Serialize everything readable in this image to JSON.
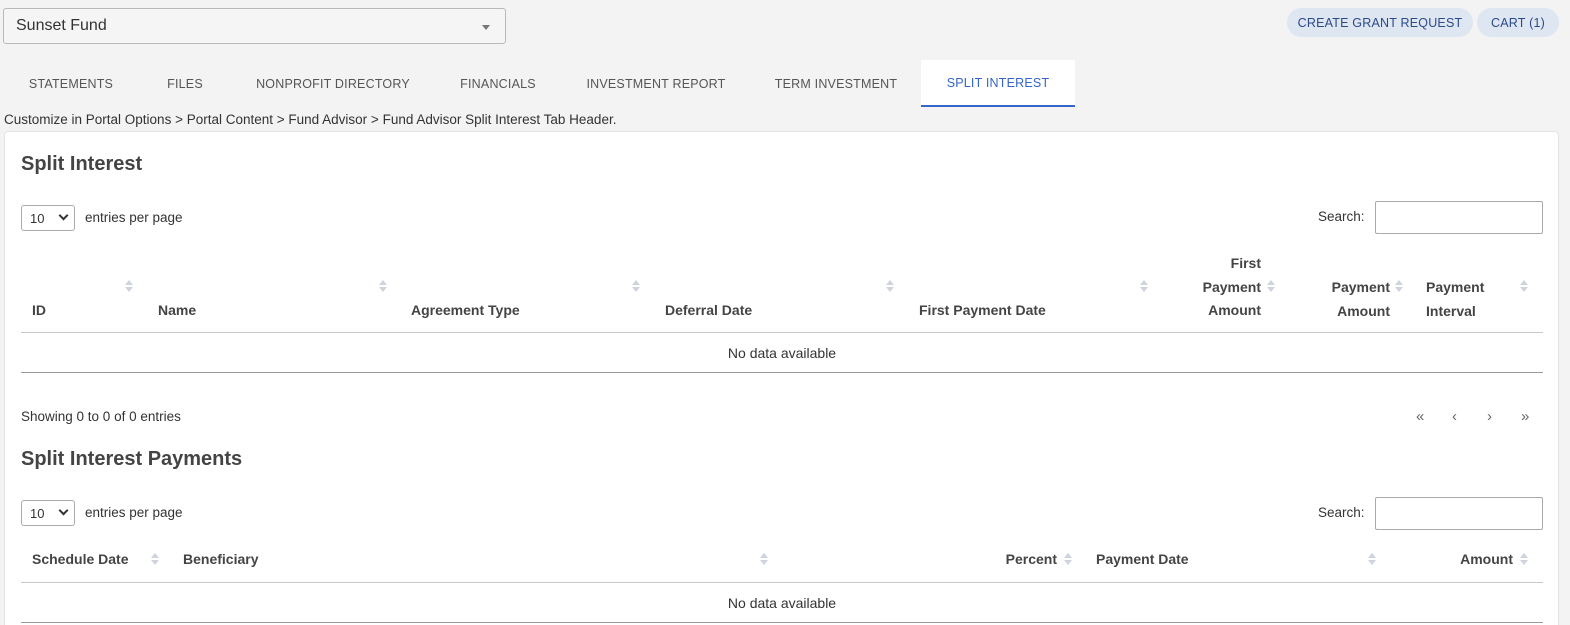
{
  "fund_selector": {
    "value": "Sunset Fund"
  },
  "header_buttons": {
    "grant": "CREATE GRANT REQUEST",
    "cart": "CART (1)"
  },
  "tabs": [
    {
      "label": "STATEMENTS"
    },
    {
      "label": "FILES"
    },
    {
      "label": "NONPROFIT DIRECTORY"
    },
    {
      "label": "FINANCIALS"
    },
    {
      "label": "INVESTMENT REPORT"
    },
    {
      "label": "TERM INVESTMENT"
    },
    {
      "label": "SPLIT INTEREST",
      "active": true
    }
  ],
  "hint": "Customize in Portal Options > Portal Content > Fund Advisor > Fund Advisor Split Interest Tab Header.",
  "split_interest": {
    "title": "Split Interest",
    "entries_value": "10",
    "entries_label": "entries per page",
    "search_label": "Search:",
    "search_value": "",
    "columns": [
      {
        "label": "ID"
      },
      {
        "label": "Name"
      },
      {
        "label": "Agreement Type"
      },
      {
        "label": "Deferral Date"
      },
      {
        "label": "First Payment Date"
      },
      {
        "label": "First\nPayment\nAmount"
      },
      {
        "label": "Payment\nAmount"
      },
      {
        "label": "Payment\nInterval"
      }
    ],
    "empty_text": "No data available",
    "showing": "Showing 0 to 0 of 0 entries",
    "pager": {
      "first": "«",
      "prev": "‹",
      "next": "›",
      "last": "»"
    }
  },
  "split_interest_payments": {
    "title": "Split Interest Payments",
    "entries_value": "10",
    "entries_label": "entries per page",
    "search_label": "Search:",
    "search_value": "",
    "columns": [
      {
        "label": "Schedule Date"
      },
      {
        "label": "Beneficiary"
      },
      {
        "label": "Percent"
      },
      {
        "label": "Payment Date"
      },
      {
        "label": "Amount"
      }
    ],
    "empty_text": "No data available"
  }
}
